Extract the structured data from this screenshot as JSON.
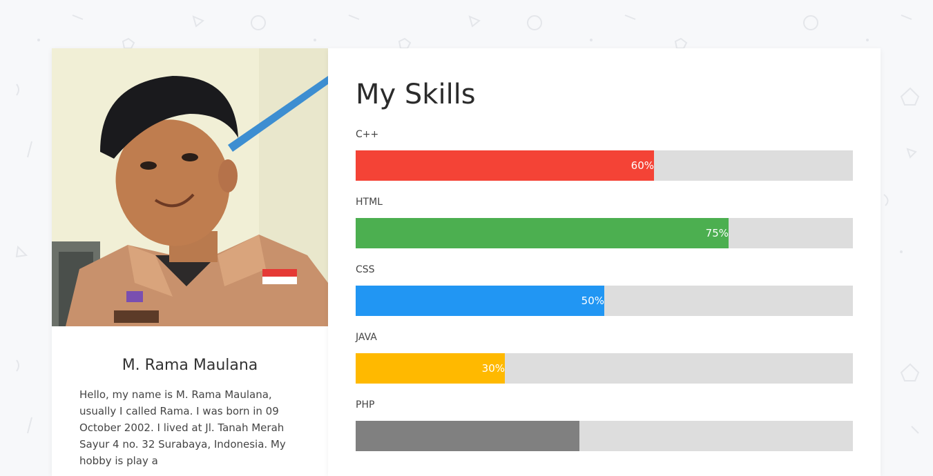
{
  "profile": {
    "name": "M. Rama Maulana",
    "bio": "Hello, my name is M. Rama Maulana, usually I called Rama. I was born in 09 October 2002. I lived at Jl. Tanah Merah Sayur 4 no. 32 Surabaya, Indonesia. My hobby is play a"
  },
  "skills": {
    "title": "My Skills",
    "items": [
      {
        "label": "C++",
        "value": 60,
        "display": "60%",
        "color": "#f44336"
      },
      {
        "label": "HTML",
        "value": 75,
        "display": "75%",
        "color": "#4caf50"
      },
      {
        "label": "CSS",
        "value": 50,
        "display": "50%",
        "color": "#2196f3"
      },
      {
        "label": "JAVA",
        "value": 30,
        "display": "30%",
        "color": "#ffb900"
      },
      {
        "label": "PHP",
        "value": 45,
        "display": "",
        "color": "#808080"
      }
    ]
  },
  "colors": {
    "background": "#f7f8fa",
    "card": "#ffffff",
    "track": "#dddddd"
  }
}
